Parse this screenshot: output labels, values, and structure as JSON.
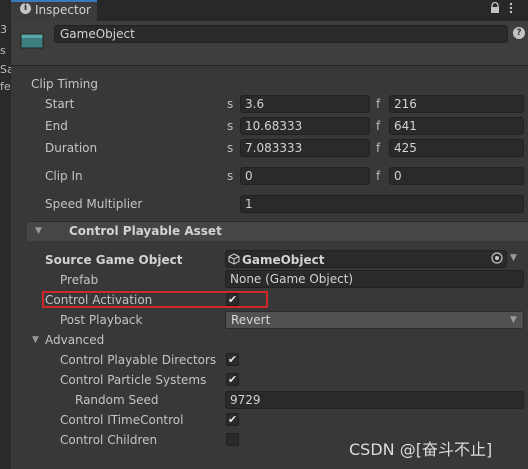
{
  "left_strip": [
    "3",
    "s",
    "Sa",
    "fe"
  ],
  "tab": {
    "icon": "info-icon",
    "label": "Inspector",
    "lock_icon": "lock-icon",
    "menu_icon": "kebab-menu-icon"
  },
  "header": {
    "icon": "gameobject-icon",
    "name": "GameObject",
    "help_icon": "help-icon"
  },
  "clip_timing": {
    "title": "Clip Timing",
    "rows": [
      {
        "label": "Start",
        "s_unit": "s",
        "s_value": "3.6",
        "f_unit": "f",
        "f_value": "216"
      },
      {
        "label": "End",
        "s_unit": "s",
        "s_value": "10.68333",
        "f_unit": "f",
        "f_value": "641"
      },
      {
        "label": "Duration",
        "s_unit": "s",
        "s_value": "7.083333",
        "f_unit": "f",
        "f_value": "425"
      },
      {
        "label": "Clip In",
        "s_unit": "s",
        "s_value": "0",
        "f_unit": "f",
        "f_value": "0"
      }
    ],
    "speed_label": "Speed Multiplier",
    "speed_value": "1"
  },
  "asset_section": {
    "title": "Control Playable Asset",
    "source_label": "Source Game Object",
    "source_value": "GameObject",
    "prefab_label": "Prefab",
    "prefab_value": "None (Game Object)",
    "control_activation_label": "Control Activation",
    "control_activation_checked": true,
    "post_playback_label": "Post Playback",
    "post_playback_value": "Revert",
    "advanced_label": "Advanced",
    "advanced": {
      "directors_label": "Control Playable Directors",
      "directors_checked": true,
      "particles_label": "Control Particle Systems",
      "particles_checked": true,
      "seed_label": "Random Seed",
      "seed_value": "9729",
      "itime_label": "Control ITimeControl",
      "itime_checked": true,
      "children_label": "Control Children",
      "children_checked": false
    }
  },
  "check_mark": "✔",
  "watermark": "CSDN @[奋斗不止]",
  "colors": {
    "tab_accent": "#3a79bb",
    "highlight_border": "#d0282a",
    "background": "#383838"
  }
}
